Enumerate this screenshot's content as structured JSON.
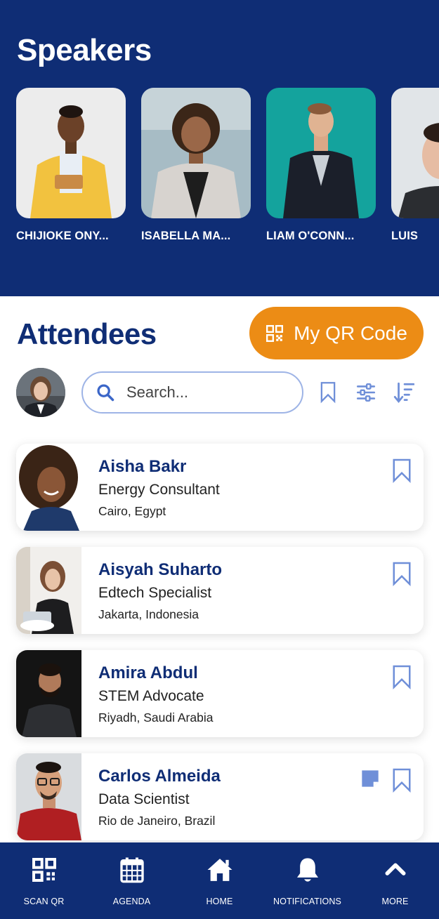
{
  "speakers": {
    "title": "Speakers",
    "items": [
      {
        "name": "CHIJIOKE ONY...",
        "bg": "#e9e9e9"
      },
      {
        "name": "ISABELLA MA...",
        "bg": "#9fb7c2"
      },
      {
        "name": "LIAM O'CONN...",
        "bg": "#12a19c"
      },
      {
        "name": "LUIS",
        "bg": "#dfe3e6"
      }
    ]
  },
  "attendees": {
    "title": "Attendees",
    "qr_button": "My QR Code",
    "search_placeholder": "Search...",
    "list": [
      {
        "name": "Aisha Bakr",
        "role": "Energy Consultant",
        "location": "Cairo, Egypt",
        "has_note": false
      },
      {
        "name": "Aisyah Suharto",
        "role": "Edtech Specialist",
        "location": "Jakarta, Indonesia",
        "has_note": false
      },
      {
        "name": "Amira Abdul",
        "role": "STEM Advocate",
        "location": "Riyadh, Saudi Arabia",
        "has_note": false
      },
      {
        "name": "Carlos Almeida",
        "role": "Data Scientist",
        "location": "Rio de Janeiro, Brazil",
        "has_note": true
      }
    ]
  },
  "nav": {
    "items": [
      {
        "label": "SCAN QR",
        "icon": "qr-code-icon"
      },
      {
        "label": "AGENDA",
        "icon": "calendar-icon"
      },
      {
        "label": "HOME",
        "icon": "home-icon"
      },
      {
        "label": "NOTIFICATIONS",
        "icon": "bell-icon"
      },
      {
        "label": "MORE",
        "icon": "chevron-up-icon"
      }
    ]
  },
  "colors": {
    "brand_navy": "#0f2d75",
    "accent_orange": "#ec8c15",
    "icon_blue": "#6f8fd8"
  }
}
